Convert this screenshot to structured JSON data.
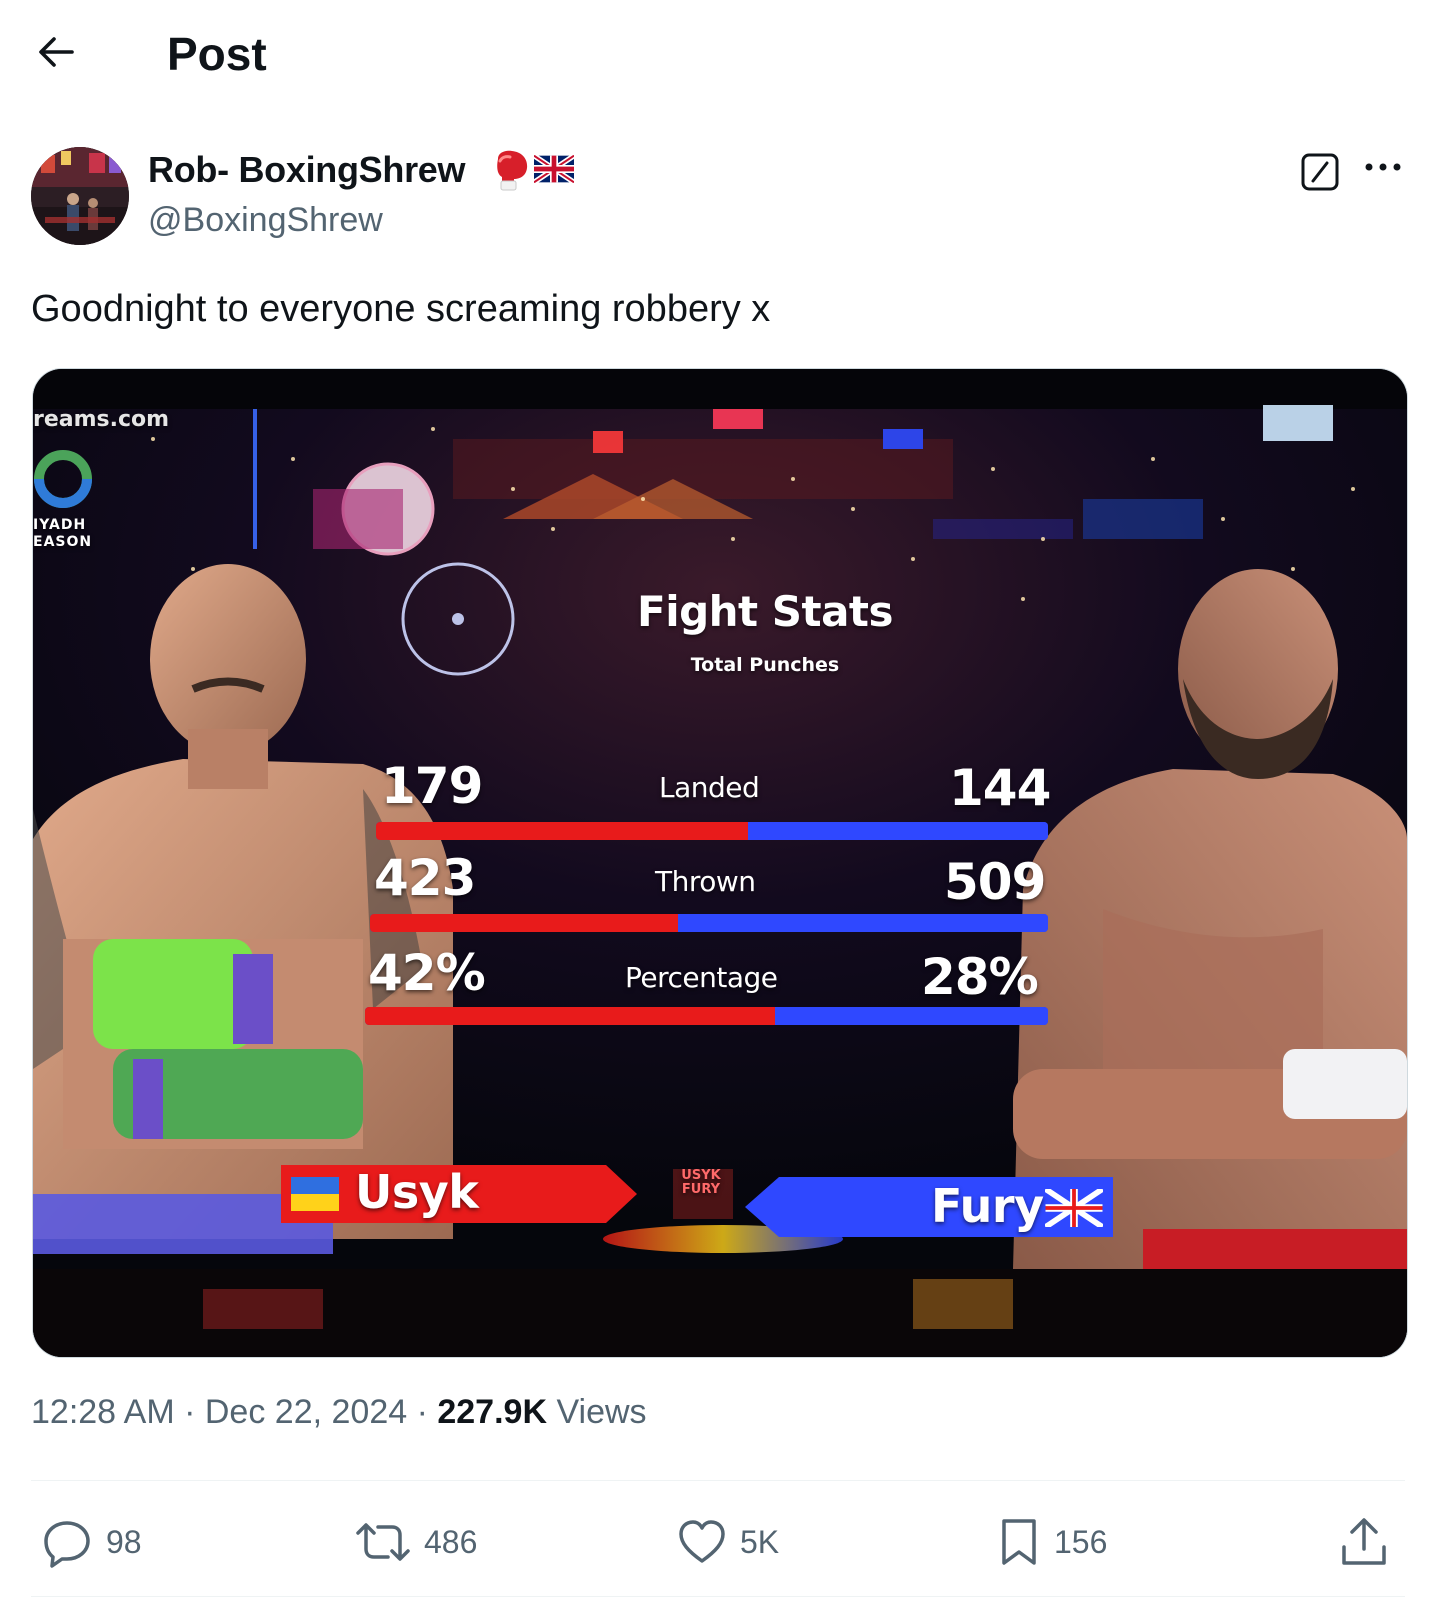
{
  "header": {
    "title": "Post",
    "back_icon": "arrow-left-icon"
  },
  "author": {
    "display_name": "Rob- BoxingShrew",
    "handle": "@BoxingShrew",
    "emoji": [
      "boxing-glove-icon",
      "uk-flag-icon"
    ]
  },
  "post": {
    "text": "Goodnight to everyone screaming robbery x",
    "time": "12:28 AM",
    "sep1": " · ",
    "date": "Dec 22, 2024",
    "sep2": " · ",
    "views_count": "227.9K",
    "views_label": " Views"
  },
  "media": {
    "watermark": "reams.com",
    "sponsor_line1": "IYADH",
    "sponsor_line2": "EASON",
    "title": "Fight Stats",
    "subtitle": "Total Punches",
    "stats": [
      {
        "label": "Landed",
        "left": "179",
        "right": "144",
        "left_share": 0.554
      },
      {
        "label": "Thrown",
        "left": "423",
        "right": "509",
        "left_share": 0.454
      },
      {
        "label": "Percentage",
        "left": "42%",
        "right": "28%",
        "left_share": 0.6
      }
    ],
    "fighter_left": "Usyk",
    "fighter_right": "Fury",
    "center_logo": "USYK FURY",
    "colors": {
      "red": "#e81b1b",
      "blue": "#2f48ff"
    }
  },
  "actions": {
    "replies": "98",
    "reposts": "486",
    "likes": "5K",
    "bookmarks": "156"
  }
}
